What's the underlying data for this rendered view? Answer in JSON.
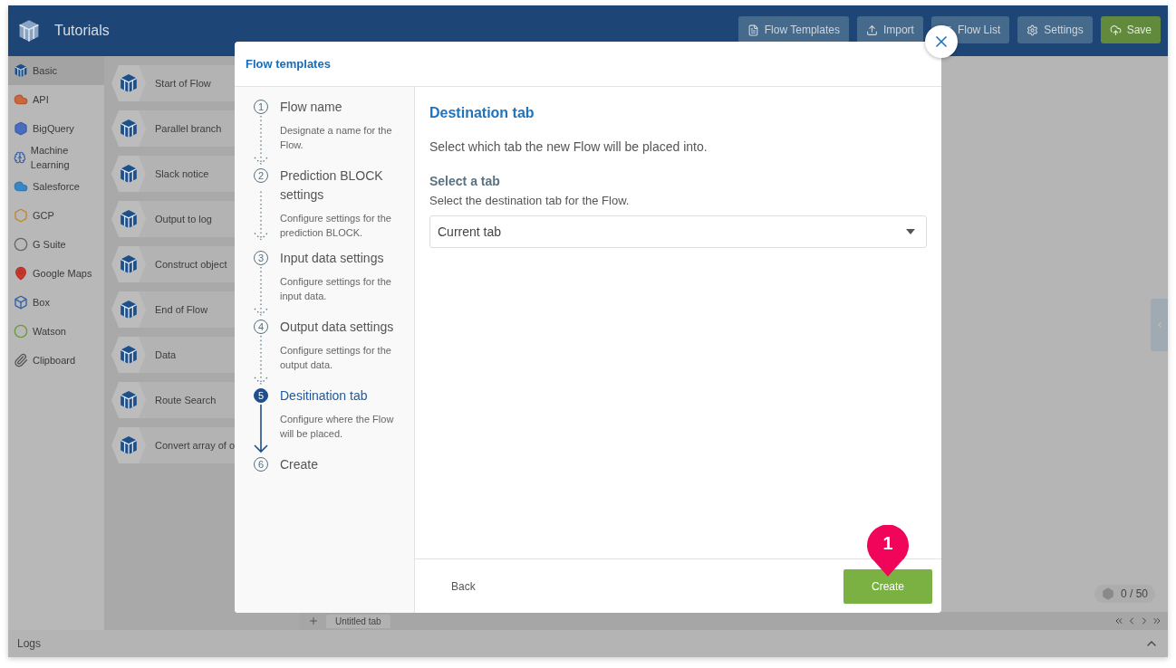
{
  "app": {
    "title": "Tutorials"
  },
  "toolbar": [
    {
      "label": "Flow Templates",
      "kind": "templates"
    },
    {
      "label": "Import",
      "kind": "import"
    },
    {
      "label": "Flow List",
      "kind": "list"
    },
    {
      "label": "Settings",
      "kind": "settings"
    },
    {
      "label": "Save",
      "kind": "save"
    }
  ],
  "sidebar": {
    "items": [
      {
        "label": "Basic",
        "kind": "basic",
        "selected": true
      },
      {
        "label": "API",
        "kind": "api",
        "selected": false
      },
      {
        "label": "BigQuery",
        "kind": "bigquery",
        "selected": false
      },
      {
        "label": "Machine Learning",
        "kind": "ml",
        "selected": false
      },
      {
        "label": "Salesforce",
        "kind": "salesforce",
        "selected": false
      },
      {
        "label": "GCP",
        "kind": "gcp",
        "selected": false
      },
      {
        "label": "G Suite",
        "kind": "gsuite",
        "selected": false
      },
      {
        "label": "Google Maps",
        "kind": "maps",
        "selected": false
      },
      {
        "label": "Box",
        "kind": "box",
        "selected": false
      },
      {
        "label": "Watson",
        "kind": "watson",
        "selected": false
      },
      {
        "label": "Clipboard",
        "kind": "clipboard",
        "selected": false
      }
    ]
  },
  "blocks": [
    "Start of Flow",
    "Parallel branch",
    "Slack notice",
    "Output to log",
    "Construct object",
    "End of Flow",
    "Data",
    "Route Search",
    "Convert array of o"
  ],
  "canvas": {
    "tabs": [
      {
        "label": "Untitled tab"
      }
    ],
    "counter": "0 / 50"
  },
  "logs": {
    "label": "Logs"
  },
  "dialog": {
    "title": "Flow templates",
    "steps": [
      {
        "number": "1",
        "title": "Flow name",
        "description": "Designate a name for the Flow.",
        "selected": false
      },
      {
        "number": "2",
        "title": "Prediction BLOCK settings",
        "description": "Configure settings for the prediction BLOCK.",
        "selected": false
      },
      {
        "number": "3",
        "title": "Input data settings",
        "description": "Configure settings for the input data.",
        "selected": false
      },
      {
        "number": "4",
        "title": "Output data settings",
        "description": "Configure settings for the output data.",
        "selected": false
      },
      {
        "number": "5",
        "title": "Desitination tab",
        "description": "Configure where the Flow will be placed.",
        "selected": true
      },
      {
        "number": "6",
        "title": "Create",
        "selected": false
      }
    ],
    "heading": "Destination tab",
    "intro": "Select which tab the new Flow will be placed into.",
    "field": {
      "label": "Select a tab",
      "help": "Select the destination tab for the Flow.",
      "value": "Current tab"
    },
    "back": "Back",
    "create": "Create",
    "marker": "1"
  }
}
